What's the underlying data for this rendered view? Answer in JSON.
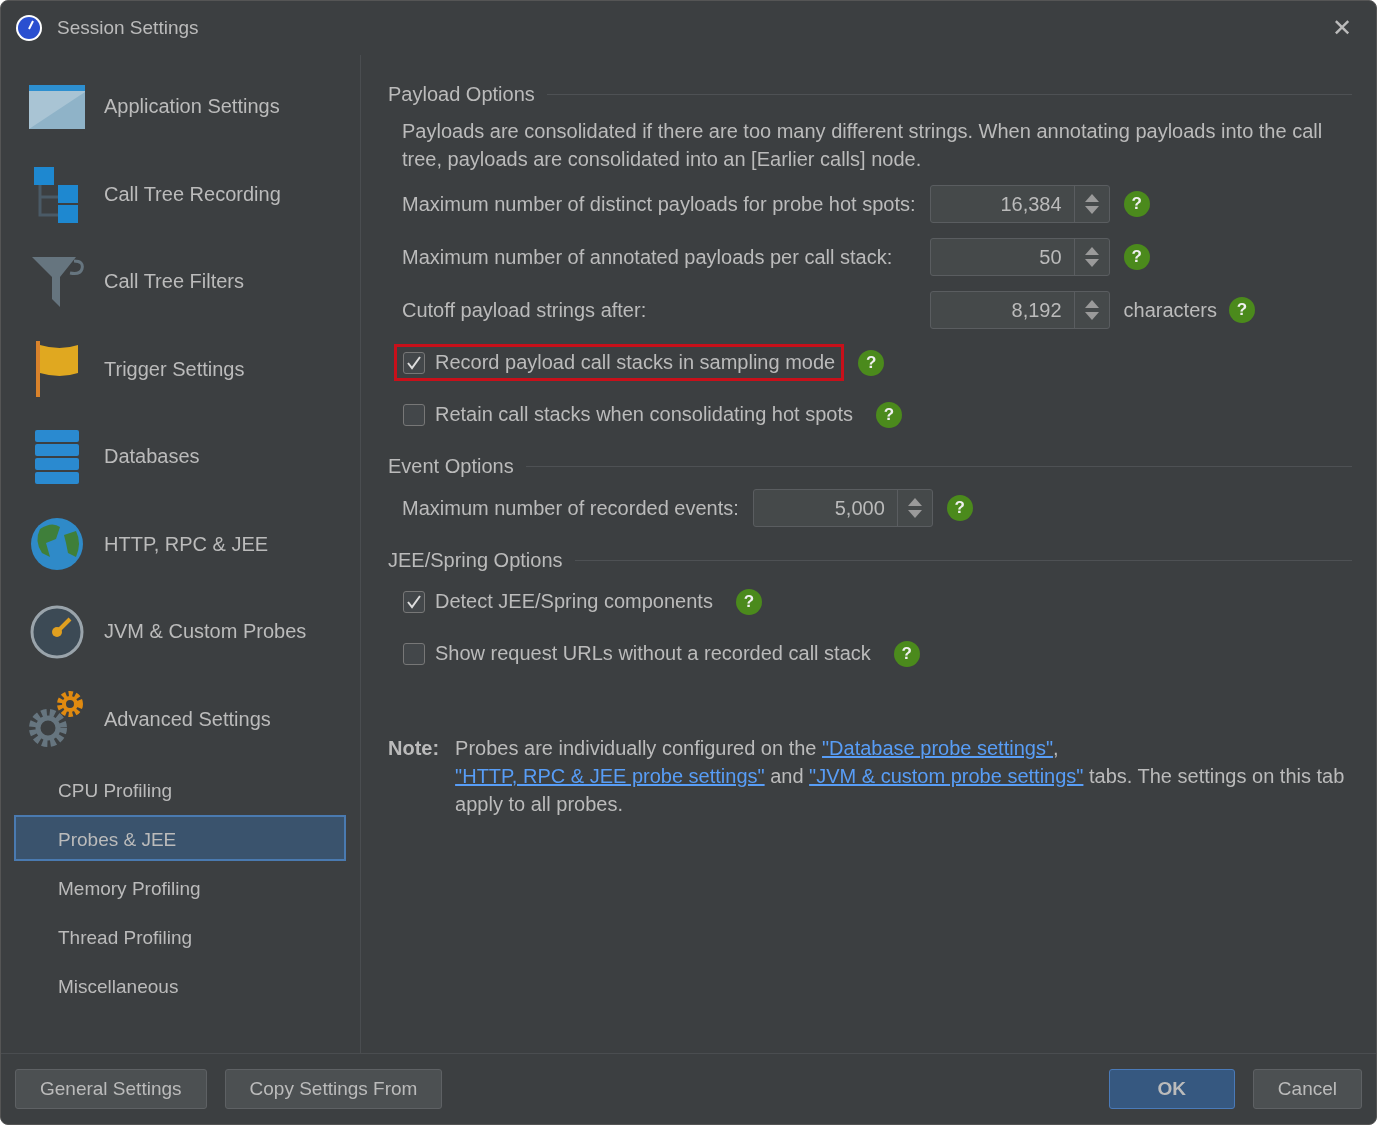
{
  "window": {
    "title": "Session Settings",
    "close": "✕"
  },
  "sidebar": {
    "items": [
      {
        "label": "Application Settings",
        "selected": false
      },
      {
        "label": "Call Tree Recording",
        "selected": false
      },
      {
        "label": "Call Tree Filters",
        "selected": false
      },
      {
        "label": "Trigger Settings",
        "selected": false
      },
      {
        "label": "Databases",
        "selected": false
      },
      {
        "label": "HTTP, RPC & JEE",
        "selected": false
      },
      {
        "label": "JVM & Custom Probes",
        "selected": false
      },
      {
        "label": "Advanced Settings",
        "selected": false
      }
    ],
    "subitems": [
      {
        "label": "CPU Profiling",
        "selected": false
      },
      {
        "label": "Probes & JEE",
        "selected": true
      },
      {
        "label": "Memory Profiling",
        "selected": false
      },
      {
        "label": "Thread Profiling",
        "selected": false
      },
      {
        "label": "Miscellaneous",
        "selected": false
      }
    ]
  },
  "sections": [
    {
      "title": "Payload Options",
      "description": "Payloads are consolidated if there are too many different strings. When annotating payloads into the call tree, payloads are consolidated into an [Earlier calls] node.",
      "rows": [
        {
          "kind": "spinner",
          "label": "Maximum number of distinct payloads for probe hot spots:",
          "value": "16,384",
          "help": "?"
        },
        {
          "kind": "spinner",
          "label": "Maximum number of annotated payloads per call stack:",
          "value": "50",
          "help": "?"
        },
        {
          "kind": "spinner",
          "label": "Cutoff payload strings after:",
          "value": "8,192",
          "unit": "characters",
          "help": "?"
        },
        {
          "kind": "checkbox",
          "label": "Record payload call stacks in sampling mode",
          "checked": true,
          "highlighted": true,
          "help": "?"
        },
        {
          "kind": "checkbox",
          "label": "Retain call stacks when consolidating hot spots",
          "checked": false,
          "help": "?"
        }
      ]
    },
    {
      "title": "Event Options",
      "rows": [
        {
          "kind": "spinner",
          "label": "Maximum number of recorded events:",
          "value": "5,000",
          "help": "?"
        }
      ]
    },
    {
      "title": "JEE/Spring Options",
      "rows": [
        {
          "kind": "checkbox",
          "label": "Detect JEE/Spring components",
          "checked": true,
          "help": "?"
        },
        {
          "kind": "checkbox",
          "label": "Show request URLs without a recorded call stack",
          "checked": false,
          "help": "?"
        }
      ]
    }
  ],
  "note": {
    "label": "Note:",
    "parts": [
      {
        "kind": "text",
        "text": "Probes are individually configured on the "
      },
      {
        "kind": "link",
        "text": "\"Database probe settings\""
      },
      {
        "kind": "text",
        "text": ", "
      },
      {
        "kind": "link",
        "text": "\"HTTP, RPC & JEE probe settings\""
      },
      {
        "kind": "text",
        "text": " and "
      },
      {
        "kind": "link",
        "text": "\"JVM & custom probe settings\""
      },
      {
        "kind": "text",
        "text": " tabs. The settings on this tab apply to all probes."
      }
    ]
  },
  "buttons_left": [
    {
      "label": "General Settings",
      "default": false
    },
    {
      "label": "Copy Settings From",
      "default": false
    }
  ],
  "buttons_right": [
    {
      "label": "OK",
      "default": true
    },
    {
      "label": "Cancel",
      "default": false
    }
  ]
}
